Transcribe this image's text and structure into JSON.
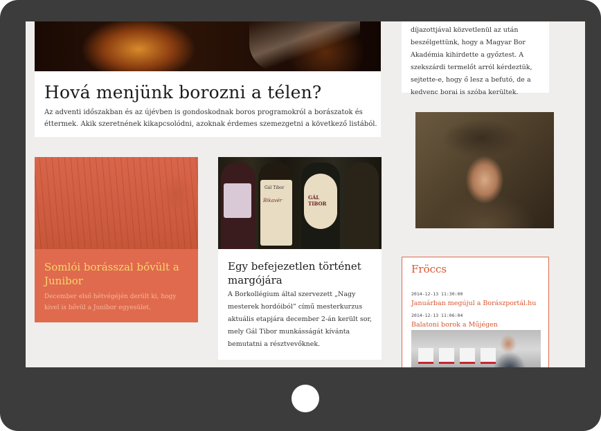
{
  "featured": {
    "title": "Hová menjünk borozni a télen?",
    "body": "Az adventi időszakban és az újévben is gondoskodnak boros programokról a borászatok és éttermek. Akik szeretnének kikapcsolódni, azoknak érdemes szemezgetni a következő listából."
  },
  "right_text": {
    "body": "díjazottjával közvetlenül az után beszélgettünk, hogy a Magyar Bor Akadémia kihirdette a győztest. A szekszárdi termelőt arról kérdeztük, sejtette-e, hogy ő lesz a befutó, de a kedvenc borai is szóba kerültek."
  },
  "promo": {
    "title": "Somlói borásszal bővült a Junibor",
    "body": "December első hétvégéjén derült ki, hogy kivel is bővül a Junibor egyesület."
  },
  "wine_article": {
    "title": "Egy befejezetlen történet margójára",
    "body": "A Borkollégium által szervezett „Nagy mesterek hordóiból” című mesterkurzus aktuális etapjára december 2-án került sor, mely Gál Tibor munkásságát kívánta bemutatni a résztvevőknek.",
    "labels": [
      "Gál Tibor",
      "Bikavér",
      "GÁL TIBOR"
    ]
  },
  "froccs": {
    "heading": "Fröccs",
    "items": [
      {
        "time": "2014-12-13 11:30:00",
        "title": "Januárban megújul a Borászportál.hu"
      },
      {
        "time": "2014-12-13 11:06:04",
        "title": "Balatoni borok a Műjégen"
      }
    ]
  },
  "colors": {
    "device_frame": "#3c3c3c",
    "screen_bg": "#efeeec",
    "accent": "#e06a4d",
    "link": "#d9552f",
    "promo_title": "#f6d56c"
  }
}
